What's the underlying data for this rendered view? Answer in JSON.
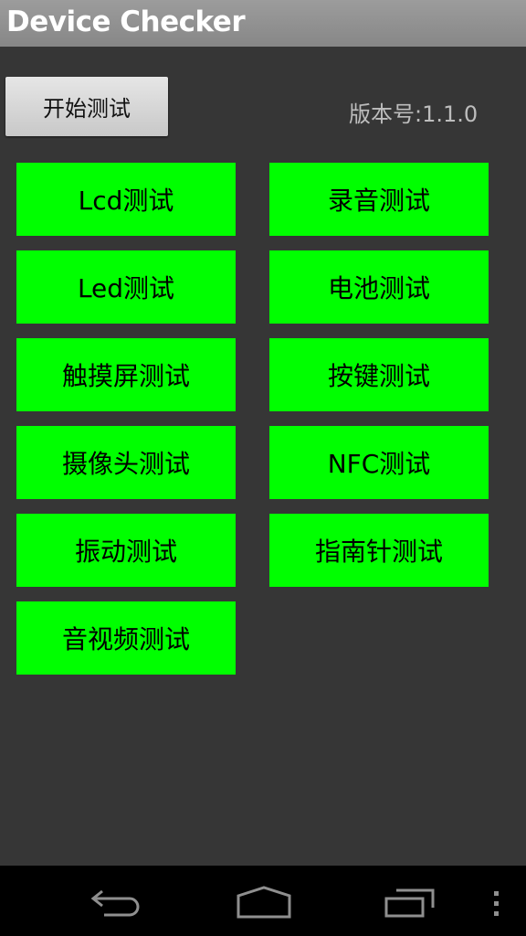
{
  "app": {
    "title": "Device Checker"
  },
  "toolbar": {
    "start_label": "开始测试",
    "version_text": "版本号:1.1.0"
  },
  "tests": [
    {
      "label": "Lcd测试"
    },
    {
      "label": "录音测试"
    },
    {
      "label": "Led测试"
    },
    {
      "label": "电池测试"
    },
    {
      "label": "触摸屏测试"
    },
    {
      "label": "按键测试"
    },
    {
      "label": "摄像头测试"
    },
    {
      "label": "NFC测试"
    },
    {
      "label": "振动测试"
    },
    {
      "label": "指南针测试"
    },
    {
      "label": "音视频测试"
    }
  ],
  "navbar": {
    "icons": [
      "back-icon",
      "home-icon",
      "recent-apps-icon",
      "overflow-menu-icon"
    ]
  },
  "colors": {
    "test_button_bg": "#00ff00",
    "background": "#363636"
  }
}
